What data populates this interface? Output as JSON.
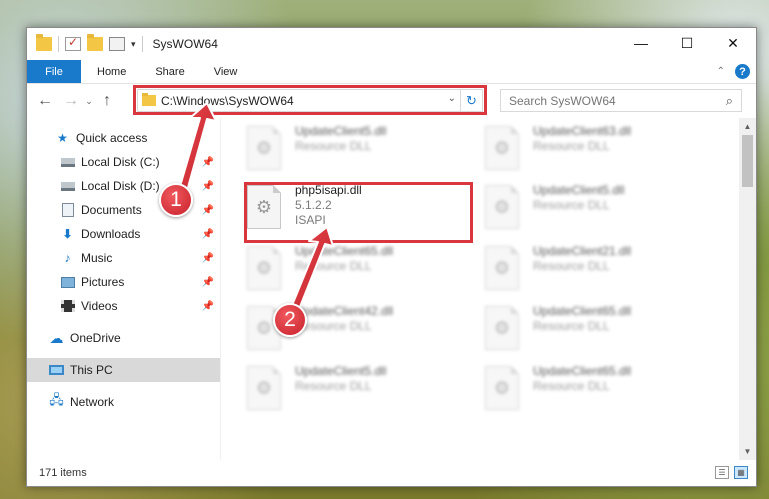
{
  "window": {
    "title": "SysWOW64",
    "controls": {
      "minimize": "—",
      "maximize": "☐",
      "close": "✕"
    }
  },
  "ribbon": {
    "tabs": [
      "File",
      "Home",
      "Share",
      "View"
    ]
  },
  "navigation": {
    "back": "←",
    "forward": "→",
    "recent": "⌄",
    "up": "↑",
    "address_path": "C:\\Windows\\SysWOW64",
    "refresh": "↻",
    "search_placeholder": "Search SysWOW64"
  },
  "sidebar": {
    "quick_access": "Quick access",
    "items": [
      {
        "label": "Local Disk (C:)",
        "icon": "drive-icon"
      },
      {
        "label": "Local Disk (D:)",
        "icon": "drive-icon"
      },
      {
        "label": "Documents",
        "icon": "documents-icon"
      },
      {
        "label": "Downloads",
        "icon": "downloads-icon"
      },
      {
        "label": "Music",
        "icon": "music-icon"
      },
      {
        "label": "Pictures",
        "icon": "pictures-icon"
      },
      {
        "label": "Videos",
        "icon": "videos-icon"
      }
    ],
    "onedrive": "OneDrive",
    "this_pc": "This PC",
    "network": "Network"
  },
  "files": [
    {
      "name": "UpdateClient5.dll",
      "meta1": "Resource DLL",
      "meta2": "",
      "blurred": true
    },
    {
      "name": "UpdateClient63.dll",
      "meta1": "Resource DLL",
      "meta2": "",
      "blurred": true
    },
    {
      "name": "php5isapi.dll",
      "meta1": "5.1.2.2",
      "meta2": "ISAPI",
      "blurred": false
    },
    {
      "name": "UpdateClient5.dll",
      "meta1": "Resource DLL",
      "meta2": "",
      "blurred": true
    },
    {
      "name": "UpdateClient65.dll",
      "meta1": "Resource DLL",
      "meta2": "",
      "blurred": true
    },
    {
      "name": "UpdateClient21.dll",
      "meta1": "Resource DLL",
      "meta2": "",
      "blurred": true
    },
    {
      "name": "UpdateClient42.dll",
      "meta1": "Resource DLL",
      "meta2": "",
      "blurred": true
    },
    {
      "name": "UpdateClient65.dll",
      "meta1": "Resource DLL",
      "meta2": "",
      "blurred": true
    },
    {
      "name": "UpdateClient5.dll",
      "meta1": "Resource DLL",
      "meta2": "",
      "blurred": true
    },
    {
      "name": "UpdateClient65.dll",
      "meta1": "Resource DLL",
      "meta2": "",
      "blurred": true
    }
  ],
  "status": {
    "item_count": "171 items"
  },
  "annotations": {
    "marker1": "1",
    "marker2": "2",
    "color": "#d9363e"
  }
}
